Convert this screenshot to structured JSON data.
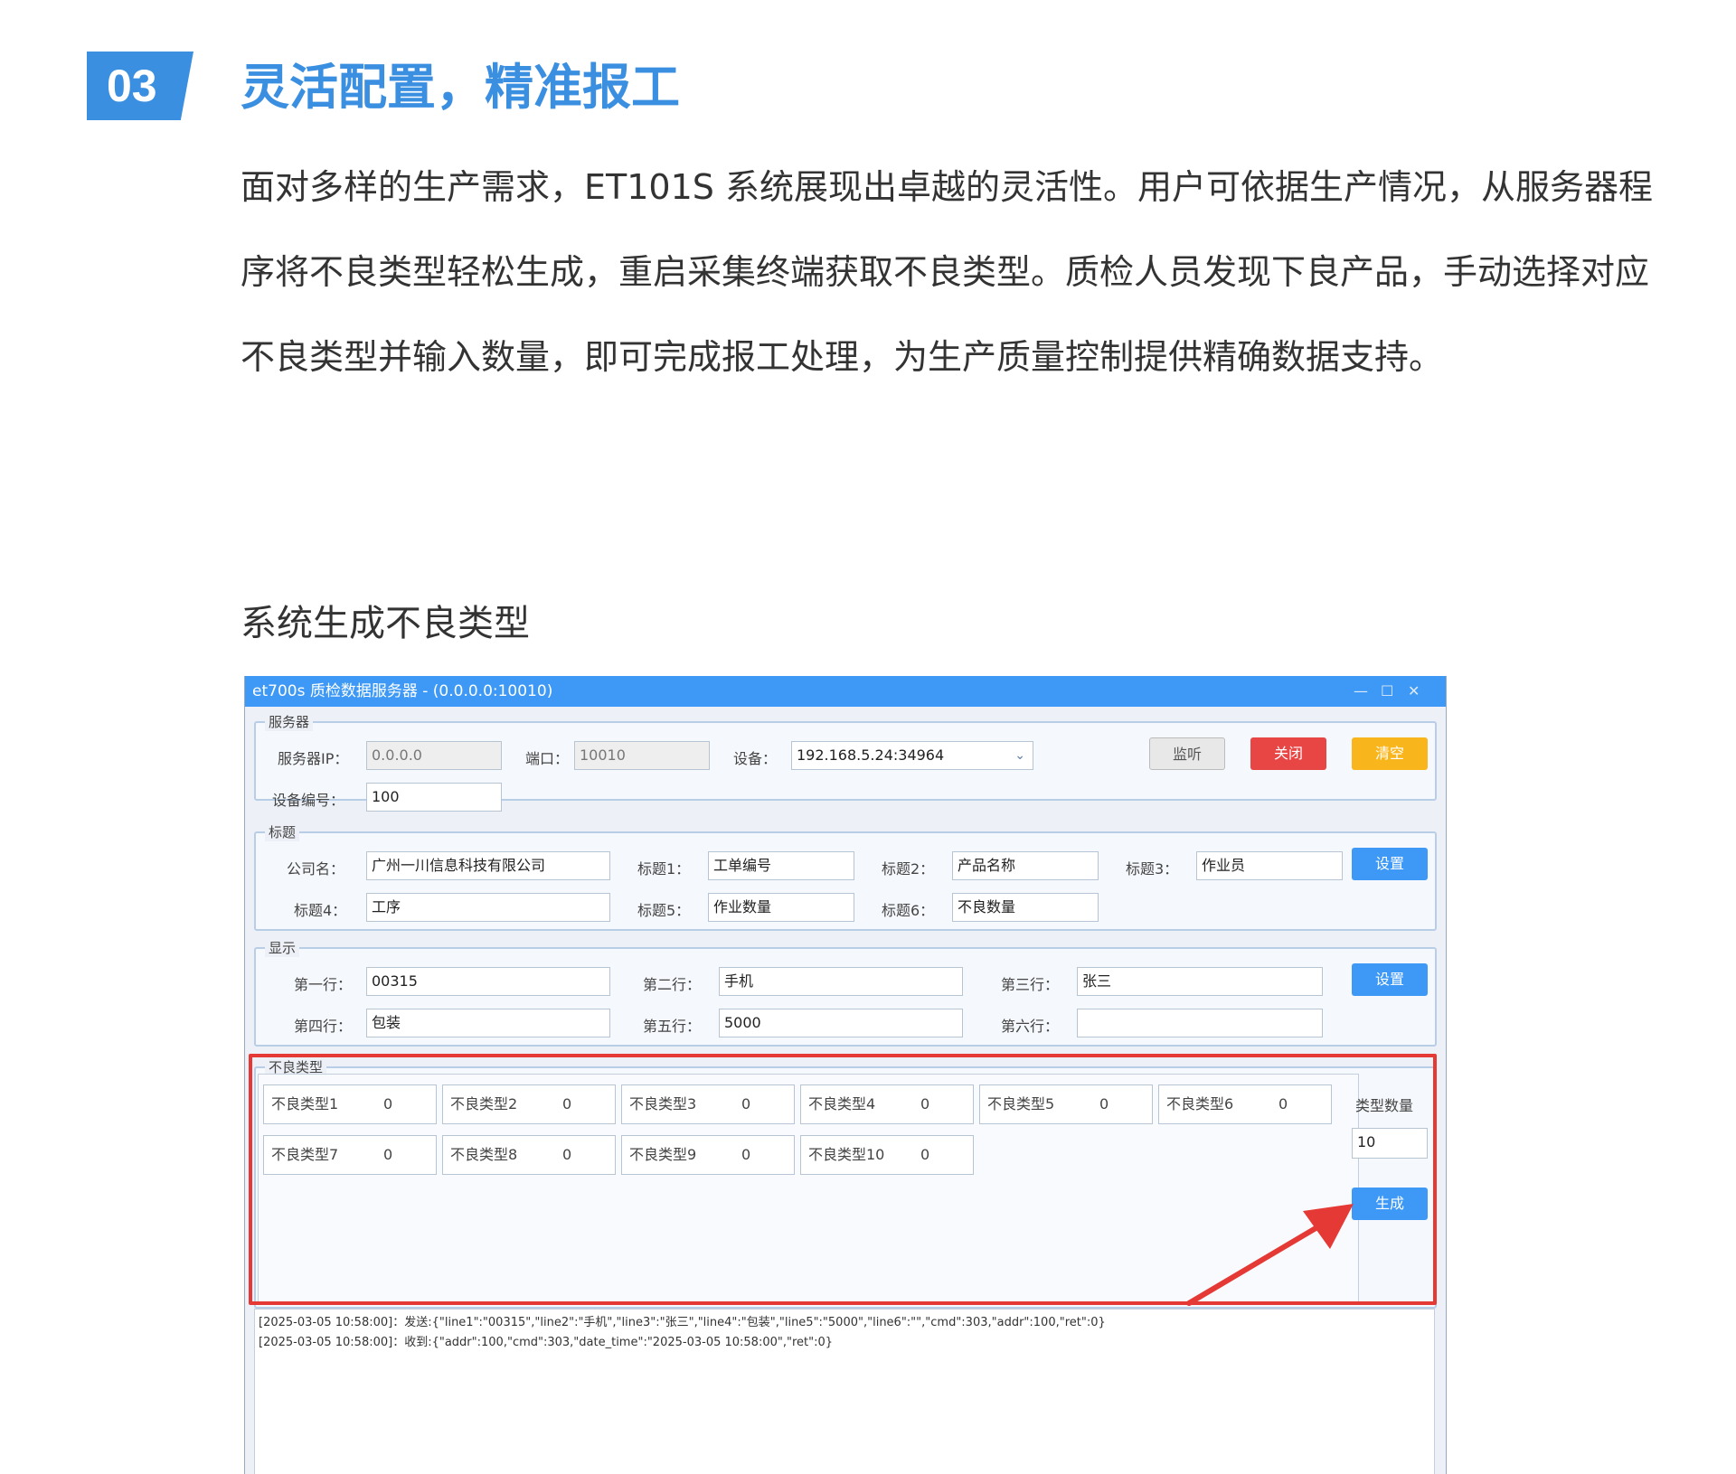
{
  "section": {
    "number": "03",
    "title": "灵活配置，精准报工",
    "intro": "面对多样的生产需求，ET101S 系统展现出卓越的灵活性。用户可依据生产情况，从服务器程序将不良类型轻松生成，重启采集终端获取不良类型。质检人员发现下良产品，手动选择对应不良类型并输入数量，即可完成报工处理，为生产质量控制提供精确数据支持。",
    "caption": "系统生成不良类型"
  },
  "window": {
    "title": "et700s 质检数据服务器 - (0.0.0.0:10010)",
    "controls": {
      "minimize": "—",
      "maximize": "☐",
      "close": "✕"
    }
  },
  "server": {
    "group_label": "服务器",
    "ip_label": "服务器IP：",
    "ip_value": "0.0.0.0",
    "port_label": "端口：",
    "port_value": "10010",
    "device_label": "设备：",
    "device_value": "192.168.5.24:34964",
    "device_no_label": "设备编号：",
    "device_no_value": "100",
    "listen_label": "监听",
    "close_label": "关闭",
    "clear_label": "清空"
  },
  "titles": {
    "group_label": "标题",
    "company_label": "公司名：",
    "company_value": "广州一川信息科技有限公司",
    "t1_label": "标题1：",
    "t1_value": "工单编号",
    "t2_label": "标题2：",
    "t2_value": "产品名称",
    "t3_label": "标题3：",
    "t3_value": "作业员",
    "t4_label": "标题4：",
    "t4_value": "工序",
    "t5_label": "标题5：",
    "t5_value": "作业数量",
    "t6_label": "标题6：",
    "t6_value": "不良数量",
    "set_label": "设置"
  },
  "display": {
    "group_label": "显示",
    "r1_label": "第一行：",
    "r1_value": "00315",
    "r2_label": "第二行：",
    "r2_value": "手机",
    "r3_label": "第三行：",
    "r3_value": "张三",
    "r4_label": "第四行：",
    "r4_value": "包装",
    "r5_label": "第五行：",
    "r5_value": "5000",
    "r6_label": "第六行：",
    "r6_value": "",
    "set_label": "设置"
  },
  "defects": {
    "group_label": "不良类型",
    "items": [
      {
        "name": "不良类型1",
        "value": "0"
      },
      {
        "name": "不良类型2",
        "value": "0"
      },
      {
        "name": "不良类型3",
        "value": "0"
      },
      {
        "name": "不良类型4",
        "value": "0"
      },
      {
        "name": "不良类型5",
        "value": "0"
      },
      {
        "name": "不良类型6",
        "value": "0"
      },
      {
        "name": "不良类型7",
        "value": "0"
      },
      {
        "name": "不良类型8",
        "value": "0"
      },
      {
        "name": "不良类型9",
        "value": "0"
      },
      {
        "name": "不良类型10",
        "value": "0"
      }
    ],
    "count_label": "类型数量",
    "count_value": "10",
    "generate_label": "生成"
  },
  "log": {
    "lines": [
      "[2025-03-05 10:58:00]：发送:{\"line1\":\"00315\",\"line2\":\"手机\",\"line3\":\"张三\",\"line4\":\"包装\",\"line5\":\"5000\",\"line6\":\"\",\"cmd\":303,\"addr\":100,\"ret\":0}",
      "[2025-03-05 10:58:00]：收到:{\"addr\":100,\"cmd\":303,\"date_time\":\"2025-03-05 10:58:00\",\"ret\":0}"
    ]
  },
  "colors": {
    "accent": "#3b8fe0",
    "titlebar": "#3d99f5",
    "close_button": "#e84545",
    "clear_button": "#f8b61c",
    "highlight": "#e53935"
  }
}
